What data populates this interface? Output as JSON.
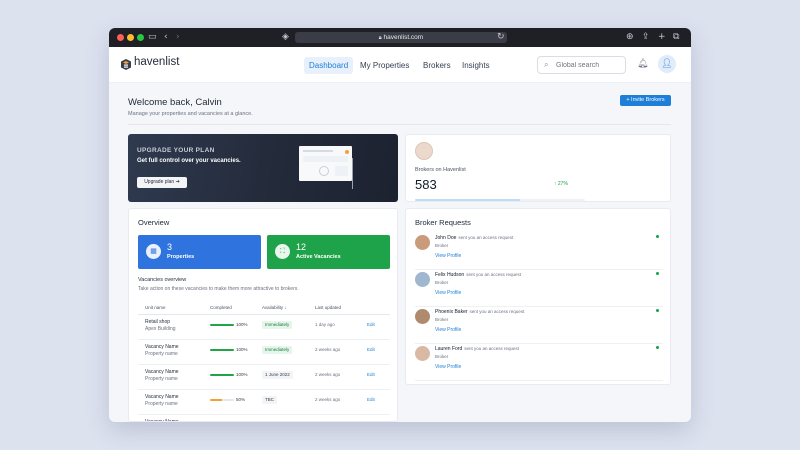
{
  "browser": {
    "url": "havenlist.com"
  },
  "app": {
    "name": "havenlist"
  },
  "nav": {
    "tabs": [
      {
        "label": "Dashboard",
        "active": true
      },
      {
        "label": "My Properties",
        "active": false
      },
      {
        "label": "Brokers",
        "active": false
      },
      {
        "label": "Insights",
        "active": false
      }
    ],
    "search_placeholder": "Global search"
  },
  "header": {
    "welcome": "Welcome back, Calvin",
    "subtitle": "Manage your properties and vacancies at a glance.",
    "invite_label": "+ Invite Brokers"
  },
  "banner": {
    "title": "UPGRADE YOUR PLAN",
    "subtitle": "Get full control over your vacancies.",
    "button_label": "Upgrade plan"
  },
  "brokers_stat": {
    "label": "Brokers on Havenlist",
    "value": "583",
    "change": "↑ 27%",
    "progress_fraction": 0.62
  },
  "overview": {
    "title": "Overview",
    "properties": {
      "count": "3",
      "label": "Properties"
    },
    "vacancies": {
      "count": "12",
      "label": "Active Vacancies"
    },
    "vac_title": "Vacancies overview",
    "vac_subtitle": "Take action on these vacancies to make them more attractive to brokers.",
    "columns": [
      "Unit name",
      "Completed",
      "Availability ↓",
      "Last updated"
    ],
    "rows": [
      {
        "unit": "Retail shop",
        "property": "Apex Building",
        "completed": 100,
        "completed_label": "100%",
        "availability": "Immediately",
        "avail_kind": "green",
        "updated": "1 day ago",
        "edit": "Edit"
      },
      {
        "unit": "Vacancy Name",
        "property": "Property name",
        "completed": 100,
        "completed_label": "100%",
        "availability": "Immediately",
        "avail_kind": "green",
        "updated": "2 weeks ago",
        "edit": "Edit"
      },
      {
        "unit": "Vacancy Name",
        "property": "Property name",
        "completed": 100,
        "completed_label": "100%",
        "availability": "1 June 2022",
        "avail_kind": "grey",
        "updated": "2 weeks ago",
        "edit": "Edit"
      },
      {
        "unit": "Vacancy Name",
        "property": "Property name",
        "completed": 50,
        "completed_label": "50%",
        "availability": "TBC",
        "avail_kind": "grey",
        "updated": "2 weeks ago",
        "edit": "Edit"
      },
      {
        "unit": "Vacancy Name",
        "property": "",
        "completed": 0,
        "completed_label": "",
        "availability": "",
        "avail_kind": "grey",
        "updated": "",
        "edit": ""
      }
    ]
  },
  "requests": {
    "title": "Broker Requests",
    "action_text": "sent you an access request",
    "role": "Broker",
    "link_label": "View Profile",
    "items": [
      {
        "name": "John Doe"
      },
      {
        "name": "Felix Hudson"
      },
      {
        "name": "Phoenix Baker"
      },
      {
        "name": "Lauren Ford"
      }
    ]
  },
  "colors": {
    "accent": "#1d7fd8",
    "properties_tile": "#2f74de",
    "vacancies_tile": "#1fa34a",
    "progress_full": "#22a447",
    "progress_half": "#f59f3a"
  },
  "icons": {
    "shield": "shield-icon",
    "search": "search-icon",
    "bell": "bell-icon",
    "user": "user-icon"
  }
}
